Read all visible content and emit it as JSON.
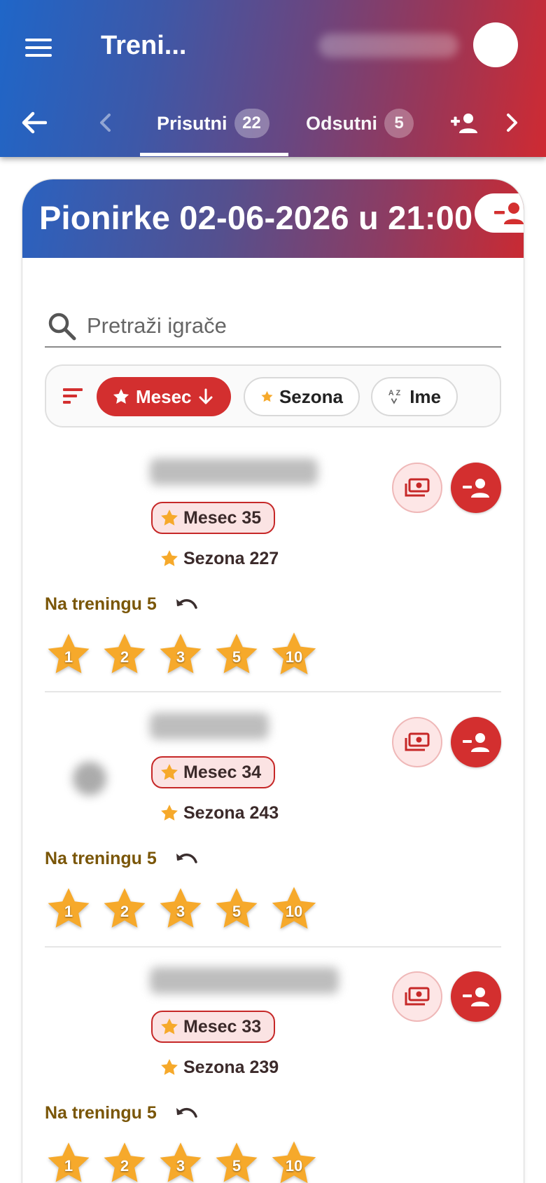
{
  "appbar": {
    "title": "Treni...",
    "tabs": [
      {
        "label": "Prisutni",
        "count": "22"
      },
      {
        "label": "Odsutni",
        "count": "5"
      }
    ]
  },
  "session": {
    "title": "Pionirke 02-06-2026 u 21:00"
  },
  "search": {
    "placeholder": "Pretraži igrače"
  },
  "sort": {
    "options": [
      {
        "label": "Mesec",
        "icon": "star-icon",
        "active": true,
        "direction": "desc"
      },
      {
        "label": "Sezona",
        "icon": "star-icon",
        "active": false
      },
      {
        "label": "Ime",
        "icon": "sort-az-icon",
        "active": false
      }
    ]
  },
  "players": [
    {
      "month": "Mesec 35",
      "season": "Sezona 227",
      "training": "Na treningu 5",
      "stars": [
        "1",
        "2",
        "3",
        "5",
        "10"
      ]
    },
    {
      "month": "Mesec 34",
      "season": "Sezona 243",
      "training": "Na treningu 5",
      "stars": [
        "1",
        "2",
        "3",
        "5",
        "10"
      ]
    },
    {
      "month": "Mesec 33",
      "season": "Sezona 239",
      "training": "Na treningu 5",
      "stars": [
        "1",
        "2",
        "3",
        "5",
        "10"
      ]
    }
  ],
  "colors": {
    "accent_red": "#d32f2f",
    "star_gold": "#f6a92b",
    "gradient_start": "#1f66c8",
    "gradient_end": "#cf2a32"
  }
}
